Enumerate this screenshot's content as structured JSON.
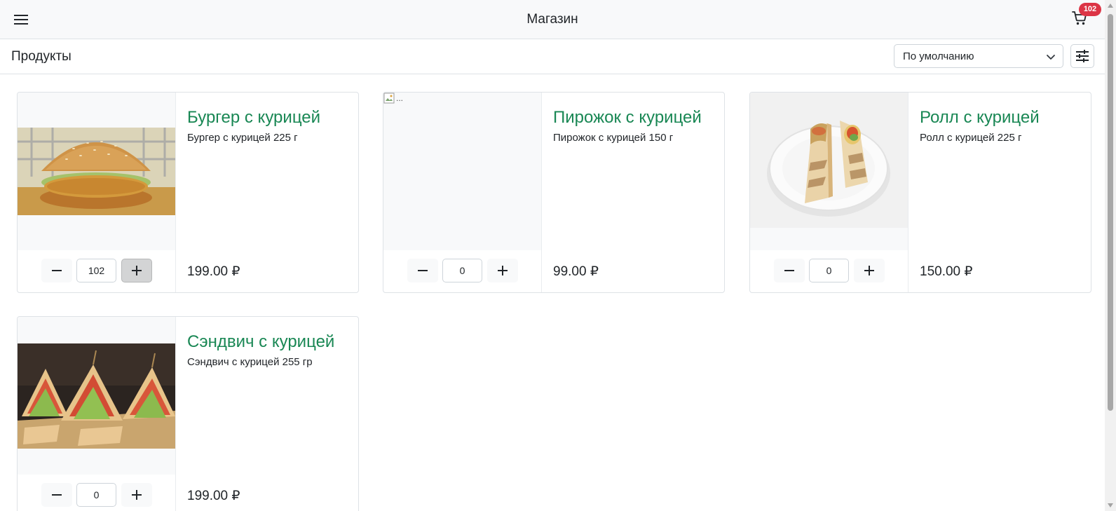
{
  "header": {
    "title": "Магазин",
    "cart_count": "102"
  },
  "toolbar": {
    "section_title": "Продукты",
    "sort_value": "По умолчанию"
  },
  "products": [
    {
      "name": "Бургер с курицей",
      "description": "Бургер с курицей 225 г",
      "price": "199.00 ₽",
      "quantity": "102"
    },
    {
      "name": "Пирожок с курицей",
      "description": "Пирожок с курицей 150 г",
      "price": "99.00 ₽",
      "quantity": "0",
      "image_alt": "..."
    },
    {
      "name": "Ролл с курицей",
      "description": "Ролл с курицей 225 г",
      "price": "150.00 ₽",
      "quantity": "0"
    },
    {
      "name": "Сэндвич с курицей",
      "description": "Сэндвич с курицей 255 гр",
      "price": "199.00 ₽",
      "quantity": "0"
    }
  ],
  "colors": {
    "accent": "#198754",
    "badge": "#dc3545",
    "header_bg": "#f8f9fa"
  },
  "icons": {
    "menu": "menu-icon",
    "cart": "cart-icon",
    "sort": "chevron-down-icon",
    "filter": "sliders-icon",
    "minus": "minus-icon",
    "plus": "plus-icon"
  }
}
